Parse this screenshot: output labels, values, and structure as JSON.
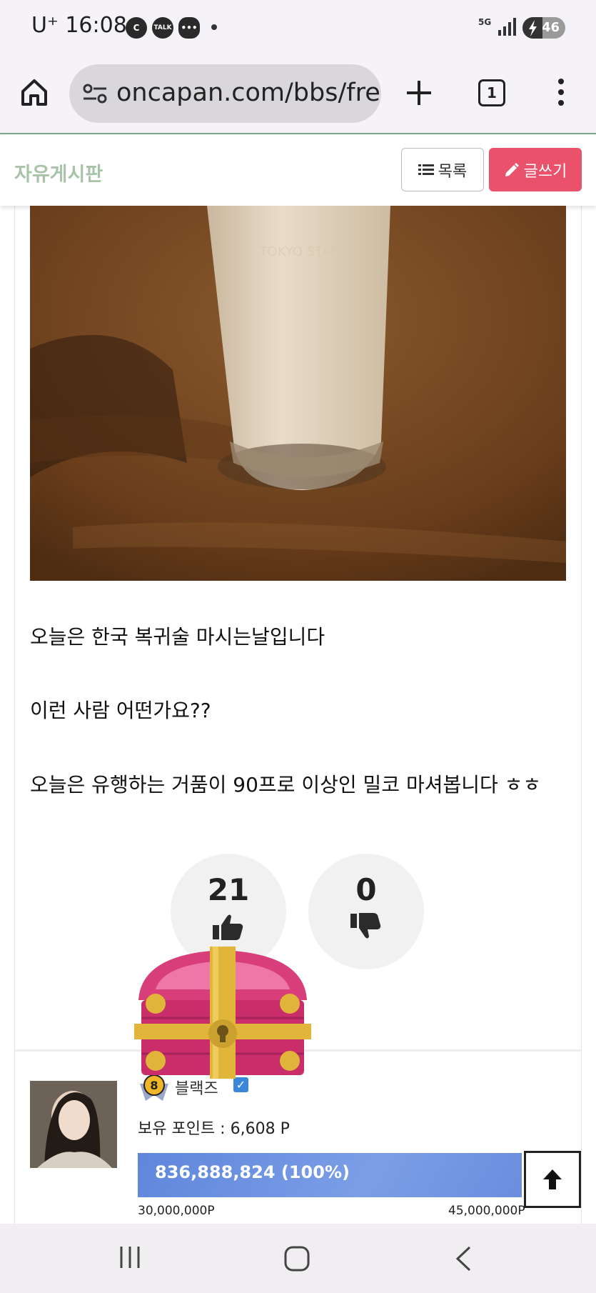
{
  "status_bar": {
    "carrier": "U⁺",
    "time": "16:08",
    "notification_icons": [
      "c-icon",
      "kakaotalk-icon",
      "chat-bubble-icon"
    ],
    "network": "5G",
    "battery": "46"
  },
  "browser": {
    "url": "oncapan.com/bbs/fre",
    "tab_count": "1"
  },
  "board": {
    "title": "자유게시판",
    "list_label": "목록",
    "write_label": "글쓰기"
  },
  "post": {
    "lines": [
      "오늘은 한국 복귀술 마시는날입니다",
      "이런 사람 어떤가요??",
      "오늘은 유행하는 거품이 90프로 이상인 밀코 마셔봅니다 ㅎㅎ"
    ],
    "likes": "21",
    "dislikes": "0"
  },
  "author": {
    "level": "8",
    "nickname": "블랙즈",
    "points_label": "보유 포인트 : 6,608 P",
    "exp_text": "836,888,824 (100%)",
    "exp_fraction": 1.0,
    "exp_min": "30,000,000P",
    "exp_max": "45,000,000P"
  },
  "colors": {
    "write_button": "#e9526a",
    "board_title": "#a9c3a8",
    "exp_bar": "#6f93e0"
  }
}
